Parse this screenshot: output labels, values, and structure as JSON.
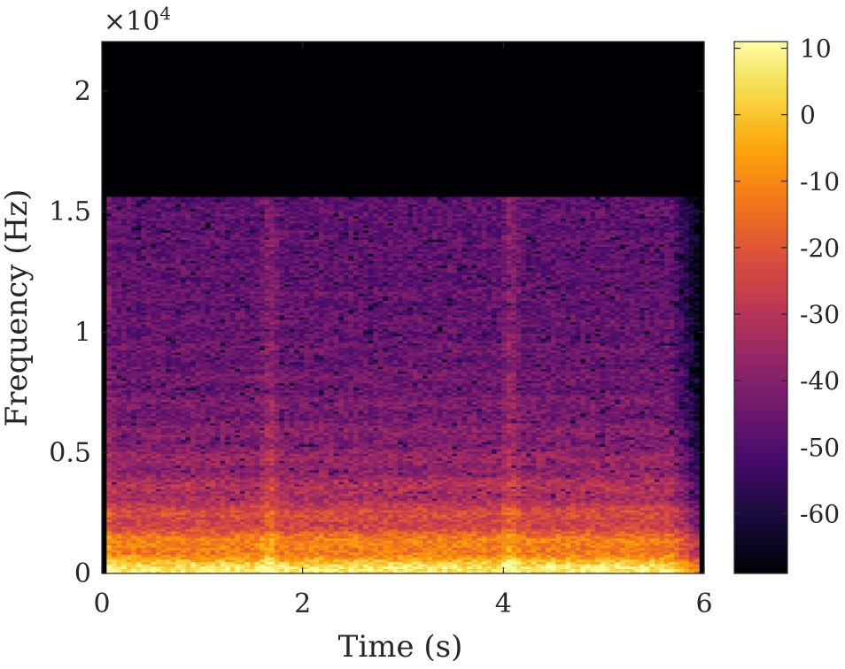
{
  "chart_data": {
    "type": "heatmap",
    "title": "",
    "xlabel": "Time (s)",
    "ylabel": "Frequency (Hz)",
    "xlim": [
      0,
      6
    ],
    "ylim": [
      0,
      22050
    ],
    "x_ticks": [
      0,
      2,
      4,
      6
    ],
    "x_tick_labels": [
      "0",
      "2",
      "4",
      "6"
    ],
    "y_ticks": [
      0,
      5000,
      10000,
      15000,
      20000
    ],
    "y_tick_labels": [
      "0",
      "0.5",
      "1",
      "1.5",
      "2"
    ],
    "y_exponent_label": "×10",
    "y_exponent_power": "4",
    "colorbar": {
      "colormap": "inferno",
      "range": [
        -69,
        11
      ],
      "ticks": [
        10,
        0,
        -10,
        -20,
        -30,
        -40,
        -50,
        -60
      ],
      "tick_labels": [
        "10",
        "0",
        "-10",
        "-20",
        "-30",
        "-40",
        "-50",
        "-60"
      ]
    },
    "content_cutoff_hz": 15600,
    "onsets_s": [
      0.0,
      1.65,
      4.05
    ],
    "signal_end_s": 5.95,
    "colors": {
      "axes_frame": "#262626",
      "background_silence": "#000004",
      "low_band": "#f9a832",
      "mid_band": "#c43c4e",
      "high_band": "#4a0c6b"
    }
  }
}
